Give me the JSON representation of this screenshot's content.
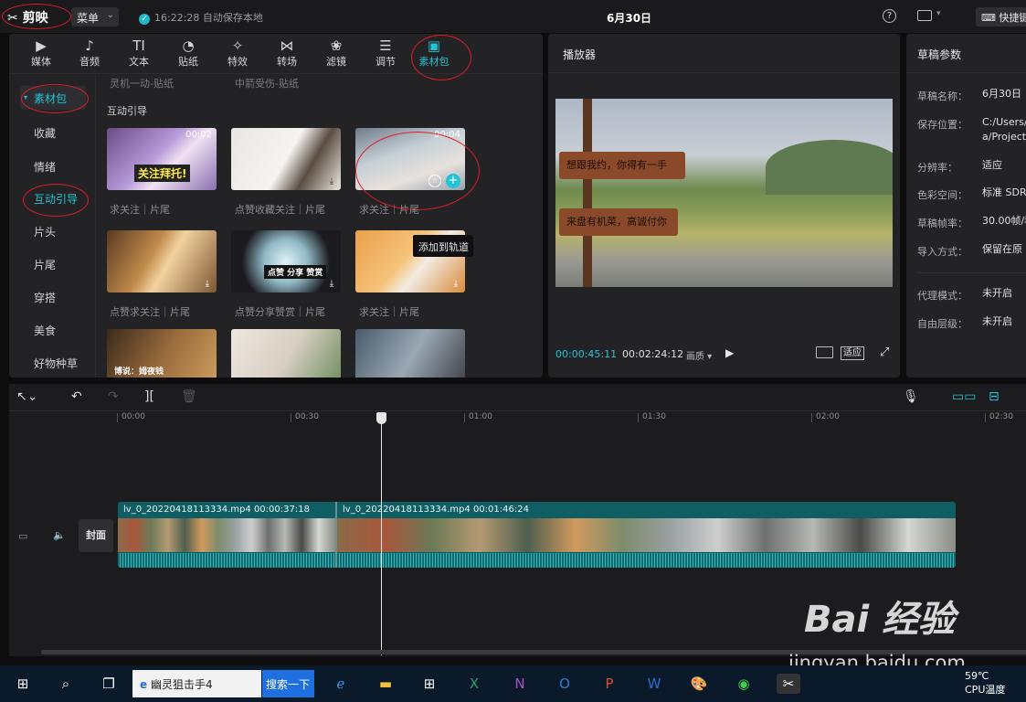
{
  "titlebar": {
    "app_name": "剪映",
    "menu_label": "菜单",
    "save_check": "✓",
    "save_status": "16:22:28 自动保存本地",
    "project_title": "6月30日",
    "help": "?",
    "shortcut_label": "快捷键"
  },
  "tabs": [
    {
      "label": "媒体",
      "icon": "media-icon"
    },
    {
      "label": "音频",
      "icon": "audio-icon"
    },
    {
      "label": "文本",
      "icon": "text-icon",
      "glyph": "TI"
    },
    {
      "label": "贴纸",
      "icon": "sticker-icon"
    },
    {
      "label": "特效",
      "icon": "effects-icon"
    },
    {
      "label": "转场",
      "icon": "transition-icon"
    },
    {
      "label": "滤镜",
      "icon": "filter-icon"
    },
    {
      "label": "调节",
      "icon": "adjust-icon"
    },
    {
      "label": "素材包",
      "icon": "material-pack-icon",
      "active": true
    }
  ],
  "sidebar": [
    "素材包",
    "收藏",
    "情绪",
    "互动引导",
    "片头",
    "片尾",
    "穿搭",
    "美食",
    "好物种草"
  ],
  "content": {
    "top_labels": [
      "灵机一动-贴纸",
      "中箭受伤-贴纸"
    ],
    "section_title": "互动引导",
    "cards": [
      {
        "label": "求关注｜片尾",
        "duration": "00:02",
        "caption": "关注拜托!"
      },
      {
        "label": "点赞收藏关注｜片尾"
      },
      {
        "label": "求关注｜片尾",
        "duration": "00:04"
      },
      {
        "label": "点赞求关注｜片尾"
      },
      {
        "label": "点赞分享赞赏｜片尾",
        "caption": "点赞 分享 赞赏"
      },
      {
        "label": "求关注｜片尾"
      },
      {
        "label": "",
        "caption": "博说：姆夜钱"
      },
      {
        "label": ""
      },
      {
        "label": ""
      }
    ],
    "tooltip": "添加到轨道"
  },
  "player": {
    "title": "播放器",
    "sign_text_1": "想跟我约，你得有一手",
    "sign_text_2": "来盘有机菜，高诚付你",
    "current_time": "00:00:45:11",
    "total_time": "00:02:24:12",
    "quality": "画质 ▾",
    "fit_label": "适应"
  },
  "draft": {
    "title": "草稿参数",
    "rows": [
      {
        "k": "草稿名称：",
        "v": "6月30日"
      },
      {
        "k": "保存位置：",
        "v": "C:/Users/\na/Project"
      },
      {
        "k": "分辨率：",
        "v": "适应"
      },
      {
        "k": "色彩空间：",
        "v": "标准 SDR"
      },
      {
        "k": "草稿帧率：",
        "v": "30.00帧/秒"
      },
      {
        "k": "导入方式：",
        "v": "保留在原"
      },
      {
        "k": "代理模式：",
        "v": "未开启"
      },
      {
        "k": "自由层级：",
        "v": "未开启"
      }
    ]
  },
  "timeline": {
    "ticks": [
      "00:00",
      "00:30",
      "01:00",
      "01:30",
      "02:00",
      "02:30"
    ],
    "clip1_label": "lv_0_20220418113334.mp4    00:00:37:18",
    "clip2_label": "lv_0_20220418113334.mp4    00:01:46:24",
    "cover_label": "封面"
  },
  "taskbar": {
    "search_text": "幽灵狙击手4",
    "search_button": "搜索一下",
    "temperature": "59℃",
    "temp_label": "CPU温度"
  },
  "watermark": {
    "brand": "Bai 经验",
    "url": "jingyan.baidu.com"
  },
  "colors": {
    "accent": "#21c3d4",
    "annotation": "#e01b24",
    "track": "#0f5e63"
  }
}
